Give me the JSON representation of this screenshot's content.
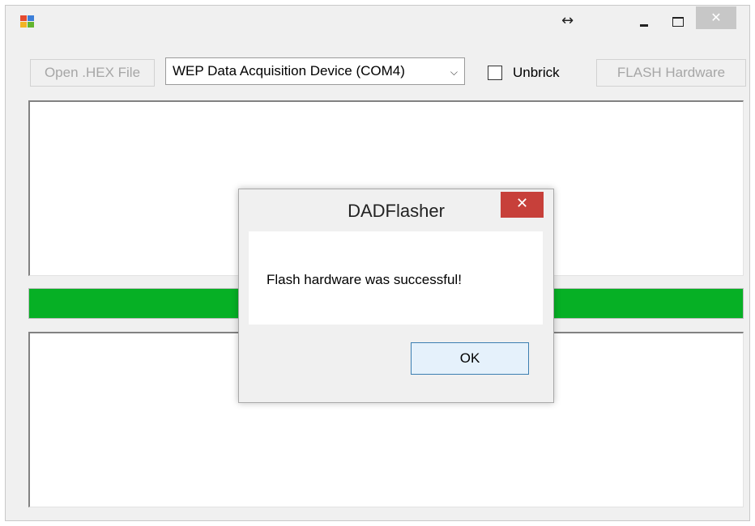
{
  "window": {
    "icons": {
      "app": "app-icon",
      "resize": "resize-arrows-icon",
      "minimize": "minimize-icon",
      "maximize": "maximize-icon",
      "close": "close-icon"
    },
    "resize_glyph": "↔",
    "close_glyph": "✕"
  },
  "toolbar": {
    "open_label": "Open .HEX File",
    "device_value": "WEP Data Acquisition Device (COM4)",
    "dropdown_arrow": "⌵",
    "unbrick_label": "Unbrick",
    "unbrick_checked": false,
    "flash_label": "FLASH Hardware"
  },
  "progress": {
    "value": 1.0,
    "color": "#06b025"
  },
  "dialog": {
    "title": "DADFlasher",
    "close_glyph": "✕",
    "message": "Flash hardware was successful!",
    "ok_label": "OK"
  },
  "colors": {
    "dialog_close": "#c7403a",
    "progress_fill": "#06b025"
  }
}
